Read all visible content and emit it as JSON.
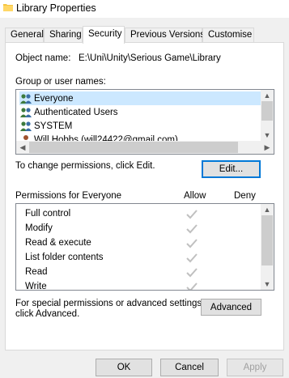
{
  "window": {
    "title": "Library Properties"
  },
  "tabs": [
    {
      "label": "General"
    },
    {
      "label": "Sharing"
    },
    {
      "label": "Security"
    },
    {
      "label": "Previous Versions"
    },
    {
      "label": "Customise"
    }
  ],
  "object": {
    "label": "Object name:",
    "value": "E:\\Uni\\Unity\\Serious Game\\Library"
  },
  "groups": {
    "label": "Group or user names:",
    "items": [
      {
        "name": "Everyone",
        "icon": "users-group-icon"
      },
      {
        "name": "Authenticated Users",
        "icon": "users-group-icon"
      },
      {
        "name": "SYSTEM",
        "icon": "users-group-icon"
      },
      {
        "name": "Will Hobbs (will24422@gmail.com)",
        "icon": "user-icon"
      }
    ]
  },
  "change_hint": "To change permissions, click Edit.",
  "edit_button": "Edit...",
  "permissions": {
    "header": "Permissions for Everyone",
    "allow_header": "Allow",
    "deny_header": "Deny",
    "rows": [
      {
        "label": "Full control",
        "allow": true,
        "deny": false
      },
      {
        "label": "Modify",
        "allow": true,
        "deny": false
      },
      {
        "label": "Read & execute",
        "allow": true,
        "deny": false
      },
      {
        "label": "List folder contents",
        "allow": true,
        "deny": false
      },
      {
        "label": "Read",
        "allow": true,
        "deny": false
      },
      {
        "label": "Write",
        "allow": true,
        "deny": false
      }
    ]
  },
  "advanced": {
    "hint_line1": "For special permissions or advanced settings,",
    "hint_line2": "click Advanced.",
    "button": "Advanced"
  },
  "footer": {
    "ok": "OK",
    "cancel": "Cancel",
    "apply": "Apply"
  },
  "colors": {
    "selection": "#cce8ff",
    "focus_border": "#0078d7",
    "check": "#c0c0c0"
  }
}
